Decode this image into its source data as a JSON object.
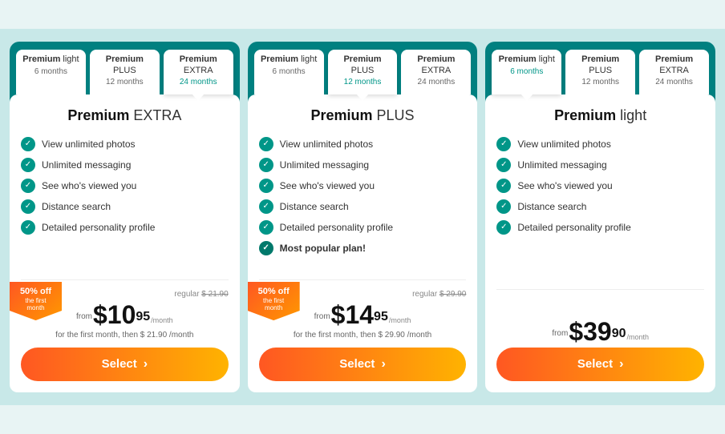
{
  "cards": [
    {
      "id": "extra",
      "tabs": [
        {
          "label": "Premium",
          "labelBold": "Premium",
          "name": "light",
          "duration": "6 months",
          "active": false
        },
        {
          "label": "Premium",
          "labelBold": "Premium",
          "name": "PLUS",
          "duration": "12 months",
          "active": false
        },
        {
          "label": "Premium",
          "labelBold": "Premium",
          "name": "EXTRA",
          "duration": "24 months",
          "active": true
        }
      ],
      "planTitle": "EXTRA",
      "planTitlePrefix": "Premium",
      "badge": "50% off",
      "badgeSub": "the first month",
      "regularPrice": "$ 21.90",
      "mainPrice": "$10",
      "mainCents": "95",
      "pricePeriod": "/month",
      "firstMonthNote": "for the first month, then $ 21.90 /month",
      "selectLabel": "Select",
      "features": [
        {
          "text": "View unlimited photos",
          "bold": false
        },
        {
          "text": "Unlimited messaging",
          "bold": false
        },
        {
          "text": "See who's viewed you",
          "bold": false
        },
        {
          "text": "Distance search",
          "bold": false
        },
        {
          "text": "Detailed personality profile",
          "bold": false
        }
      ]
    },
    {
      "id": "plus",
      "tabs": [
        {
          "label": "Premium",
          "name": "light",
          "duration": "6 months",
          "active": false
        },
        {
          "label": "Premium",
          "name": "PLUS",
          "duration": "12 months",
          "active": true
        },
        {
          "label": "Premium",
          "name": "EXTRA",
          "duration": "24 months",
          "active": false
        }
      ],
      "planTitle": "PLUS",
      "planTitlePrefix": "Premium",
      "badge": "50% off",
      "badgeSub": "the first month",
      "regularPrice": "$ 29.90",
      "mainPrice": "$14",
      "mainCents": "95",
      "pricePeriod": "/month",
      "firstMonthNote": "for the first month, then $ 29.90 /month",
      "selectLabel": "Select",
      "features": [
        {
          "text": "View unlimited photos",
          "bold": false
        },
        {
          "text": "Unlimited messaging",
          "bold": false
        },
        {
          "text": "See who's viewed you",
          "bold": false
        },
        {
          "text": "Distance search",
          "bold": false
        },
        {
          "text": "Detailed personality profile",
          "bold": false
        },
        {
          "text": "Most popular plan!",
          "bold": true
        }
      ]
    },
    {
      "id": "light",
      "tabs": [
        {
          "label": "Premium",
          "name": "light",
          "duration": "6 months",
          "active": true
        },
        {
          "label": "Premium",
          "name": "PLUS",
          "duration": "12 months",
          "active": false
        },
        {
          "label": "Premium",
          "name": "EXTRA",
          "duration": "24 months",
          "active": false
        }
      ],
      "planTitle": "light",
      "planTitlePrefix": "Premium",
      "badge": null,
      "regularPrice": null,
      "mainPrice": "$39",
      "mainCents": "90",
      "pricePeriod": "/month",
      "firstMonthNote": null,
      "selectLabel": "Select",
      "features": [
        {
          "text": "View unlimited photos",
          "bold": false
        },
        {
          "text": "Unlimited messaging",
          "bold": false
        },
        {
          "text": "See who's viewed you",
          "bold": false
        },
        {
          "text": "Distance search",
          "bold": false
        },
        {
          "text": "Detailed personality profile",
          "bold": false
        }
      ]
    }
  ]
}
